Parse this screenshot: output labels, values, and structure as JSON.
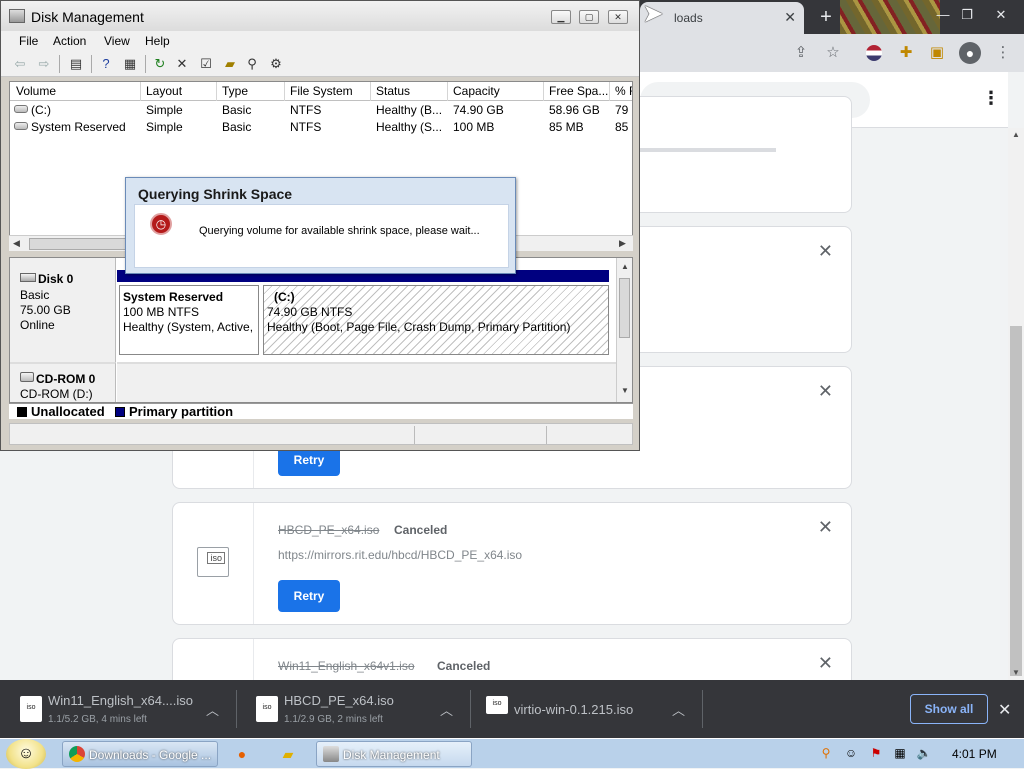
{
  "chrome": {
    "tab_title": "loads",
    "tab_close": "✕",
    "new_tab": "+",
    "win_min": "—",
    "win_max": "❐",
    "win_close": "✕"
  },
  "downloads": {
    "cards": [
      {
        "filename": "HBCD_PE_x64.iso",
        "status": "Canceled",
        "url": "https://mirrors.rit.edu/hbcd/HBCD_PE_x64.iso",
        "retry": "Retry",
        "icon_label": "iso"
      },
      {
        "filename": "Win11_English_x64v1.iso",
        "status": "Canceled"
      }
    ],
    "retry_label": "Retry"
  },
  "shelf": {
    "items": [
      {
        "name": "Win11_English_x64....iso",
        "sub": "1.1/5.2 GB, 4 mins left"
      },
      {
        "name": "HBCD_PE_x64.iso",
        "sub": "1.1/2.9 GB, 2 mins left"
      },
      {
        "name": "virtio-win-0.1.215.iso",
        "sub": ""
      }
    ],
    "show_all": "Show all"
  },
  "taskbar": {
    "chrome_task": "Downloads - Google ...",
    "dm_task": "Disk Management",
    "clock": "4:01 PM"
  },
  "disk_mgmt": {
    "title": "Disk Management",
    "menu": [
      "File",
      "Action",
      "View",
      "Help"
    ],
    "columns": [
      "Volume",
      "Layout",
      "Type",
      "File System",
      "Status",
      "Capacity",
      "Free Spa...",
      "% F"
    ],
    "volumes": [
      {
        "volume": "(C:)",
        "layout": "Simple",
        "type": "Basic",
        "fs": "NTFS",
        "status": "Healthy (B...",
        "capacity": "74.90 GB",
        "free": "58.96 GB",
        "pct": "79"
      },
      {
        "volume": "System Reserved",
        "layout": "Simple",
        "type": "Basic",
        "fs": "NTFS",
        "status": "Healthy (S...",
        "capacity": "100 MB",
        "free": "85 MB",
        "pct": "85"
      }
    ],
    "disks": [
      {
        "name": "Disk 0",
        "kind": "Basic",
        "size": "75.00 GB",
        "state": "Online"
      },
      {
        "name": "CD-ROM 0",
        "kind": "CD-ROM (D:)"
      }
    ],
    "partitions": [
      {
        "name": "System Reserved",
        "size": "100 MB NTFS",
        "status": "Healthy (System, Active,"
      },
      {
        "name": "(C:)",
        "size": "74.90 GB NTFS",
        "status": "Healthy (Boot, Page File, Crash Dump, Primary Partition)"
      }
    ],
    "legend": [
      {
        "label": "Unallocated",
        "color": "#000000"
      },
      {
        "label": "Primary partition",
        "color": "#000080"
      }
    ]
  },
  "dialog": {
    "title": "Querying Shrink Space",
    "message": "Querying volume for available shrink space, please wait..."
  }
}
